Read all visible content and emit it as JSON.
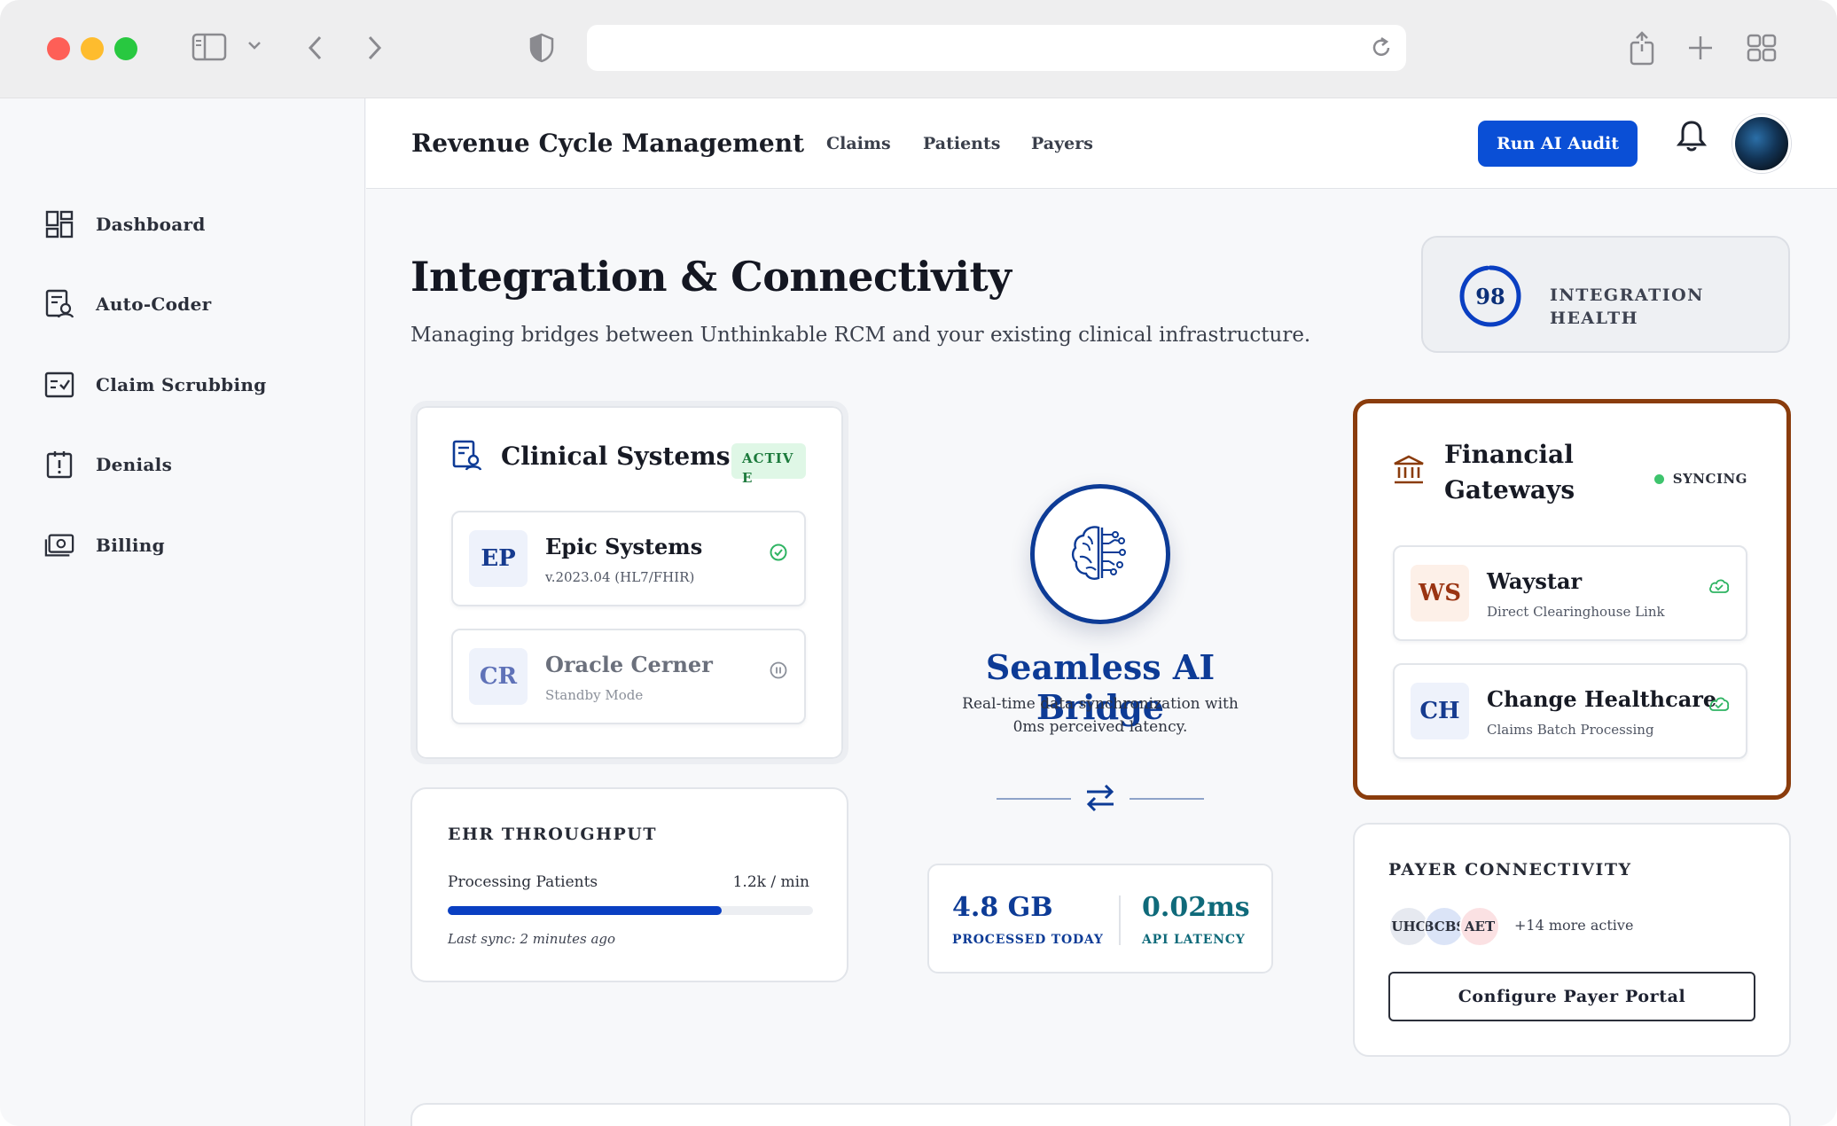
{
  "app": {
    "title": "Revenue Cycle Management",
    "tabs": [
      "Claims",
      "Patients",
      "Payers"
    ],
    "run_audit_label": "Run AI Audit",
    "accent_color": "#0a4fd6"
  },
  "sidebar": {
    "items": [
      {
        "label": "Dashboard",
        "icon": "dashboard-icon"
      },
      {
        "label": "Auto-Coder",
        "icon": "auto-coder-icon"
      },
      {
        "label": "Claim Scrubbing",
        "icon": "claim-scrubbing-icon"
      },
      {
        "label": "Denials",
        "icon": "denials-icon"
      },
      {
        "label": "Billing",
        "icon": "billing-icon"
      }
    ]
  },
  "page": {
    "title": "Integration & Connectivity",
    "subtitle": "Managing bridges between Unthinkable RCM and your existing clinical infrastructure."
  },
  "health": {
    "score": "98",
    "score_fraction": 0.98,
    "label": "INTEGRATION HEALTH"
  },
  "clinical": {
    "title": "Clinical Systems",
    "badge": "ACTIVE",
    "systems": [
      {
        "abbr": "EP",
        "name": "Epic Systems",
        "sub": "v.2023.04 (HL7/FHIR)",
        "status_icon": "check-circle-icon"
      },
      {
        "abbr": "CR",
        "name": "Oracle Cerner",
        "sub": "Standby Mode",
        "status_icon": "pause-circle-icon"
      }
    ]
  },
  "ehr": {
    "title": "EHR THROUGHPUT",
    "row_label": "Processing Patients",
    "row_value": "1.2k / min",
    "progress_fraction": 0.75,
    "last_sync": "Last sync: 2 minutes ago"
  },
  "bridge": {
    "icon": "brain-circuit-icon",
    "title": "Seamless AI Bridge",
    "subtitle": "Real-time data synchronization with 0ms perceived latency.",
    "stats": [
      {
        "value": "4.8 GB",
        "label": "PROCESSED TODAY",
        "color": "#0d3b96"
      },
      {
        "value": "0.02ms",
        "label": "API LATENCY",
        "color": "#0f6a7a"
      }
    ]
  },
  "financial": {
    "title_line1": "Financial",
    "title_line2": "Gateways",
    "status": "SYNCING",
    "border_color": "#8a3c0c",
    "gateways": [
      {
        "abbr": "WS",
        "name": "Waystar",
        "sub": "Direct Clearinghouse Link",
        "abbr_color": "#9a3412",
        "badge_bg": "#fdf0e8",
        "status_icon": "cloud-check-icon"
      },
      {
        "abbr": "CH",
        "name": "Change Healthcare",
        "sub": "Claims Batch Processing",
        "abbr_color": "#163b8f",
        "badge_bg": "#eef2fb",
        "status_icon": "cloud-check-icon"
      }
    ]
  },
  "payer": {
    "title": "PAYER CONNECTIVITY",
    "avatars": [
      {
        "label": "UHC",
        "bg": "#e6e9f0"
      },
      {
        "label": "BCBS",
        "bg": "#dbe4f7"
      },
      {
        "label": "AET",
        "bg": "#fbe1e3"
      }
    ],
    "more": "+14 more active",
    "configure_label": "Configure Payer Portal"
  }
}
